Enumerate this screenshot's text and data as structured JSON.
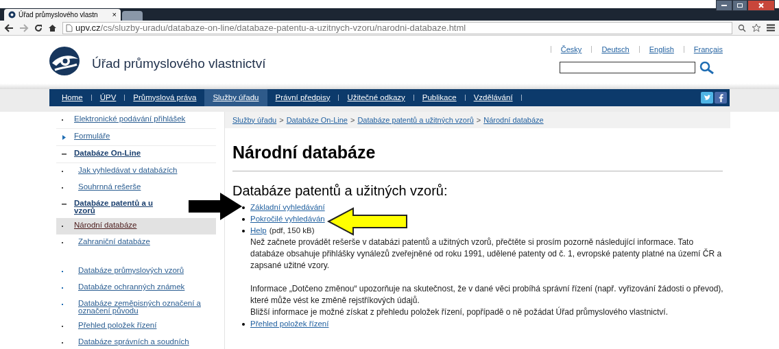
{
  "browser": {
    "tabs": [
      {
        "title": "Úřad průmyslového vlastn",
        "close": "×",
        "selected": true
      },
      {
        "selected": false
      }
    ],
    "url": {
      "host": "upv.cz",
      "path": "/cs/sluzby-uradu/databaze-on-line/databaze-patentu-a-uzitnych-vzoru/narodni-databaze.html"
    }
  },
  "header": {
    "site_title": "Úřad průmyslového vlastnictví",
    "languages": [
      {
        "label": "Česky"
      },
      {
        "label": "Deutsch"
      },
      {
        "label": "English"
      },
      {
        "label": "Français"
      }
    ]
  },
  "nav": [
    {
      "label": "Home",
      "selected": false
    },
    {
      "label": "ÚPV",
      "selected": false
    },
    {
      "label": "Průmyslová práva",
      "selected": false
    },
    {
      "label": "Služby úřadu",
      "selected": true
    },
    {
      "label": "Právní předpisy",
      "selected": false
    },
    {
      "label": "Užitečné odkazy",
      "selected": false
    },
    {
      "label": "Publikace",
      "selected": false
    },
    {
      "label": "Vzdělávání",
      "selected": false
    }
  ],
  "sidebar": {
    "items": [
      {
        "label": "Elektronické podávání přihlášek",
        "kind": "link"
      },
      {
        "label": "Formuláře",
        "kind": "collapsed"
      },
      {
        "label": "Databáze On-Line",
        "kind": "expanded",
        "children": [
          {
            "label": "Jak vyhledávat v databázích",
            "kind": "link"
          },
          {
            "label": "Souhrnná rešerše",
            "kind": "link"
          },
          {
            "label": "Databáze patentů a u",
            "label_line_2": "vzorů",
            "kind": "expanded",
            "children": [
              {
                "label": "Národní databáze",
                "kind": "link",
                "selected": true
              },
              {
                "label": "Zahraniční databáze",
                "kind": "link",
                "selected": false
              }
            ]
          },
          {
            "label": "Databáze průmyslových vzorů",
            "kind": "accent",
            "gap_before": true
          },
          {
            "label": "Databáze ochranných známek",
            "kind": "accent"
          },
          {
            "label": "Databáze zeměpisných označení a označení původu",
            "kind": "accent"
          },
          {
            "label": "Přehled položek řízení",
            "kind": "link"
          },
          {
            "label": "Databáze správních a soudních",
            "kind": "link"
          }
        ]
      }
    ]
  },
  "content": {
    "breadcrumb": {
      "separator": ">",
      "items": [
        "Služby úřadu",
        "Databáze On-Line",
        "Databáze patentů a užitných vzorů",
        "Národní databáze"
      ]
    },
    "title": "Národní databáze",
    "subtitle": "Databáze patentů a užitných vzorů:",
    "list": [
      {
        "link": "Základní vyhledávání"
      },
      {
        "link": "Pokročilé vyhledáván"
      },
      {
        "link": "Help",
        "suffix": "(pdf, 150 kB)",
        "paragraphs": [
          {
            "text": "Než začnete provádět rešerše v databázi patentů a užitných vzorů, přečtěte si prosím pozorně následující informace. Tato databáze obsahuje přihlášky vynálezů zveřejněné od roku 1991, udělené patenty od č. 1, evropské patenty platné na území ČR a zapsané užitné vzory."
          },
          {
            "text": "Informace „Dotčeno změnou“ upozorňuje na skutečnost, že v dané věci probíhá správní řízení (např. vyřizování žádosti o převod), které může vést ke změně rejstříkových údajů.",
            "gap_before": true
          },
          {
            "text": "Bližší informace je možné získat z přehledu položek řízení, popřípadě o ně požádat Úřad průmyslového vlastnictví."
          }
        ]
      },
      {
        "link": "Přehled položek řízení"
      }
    ]
  }
}
